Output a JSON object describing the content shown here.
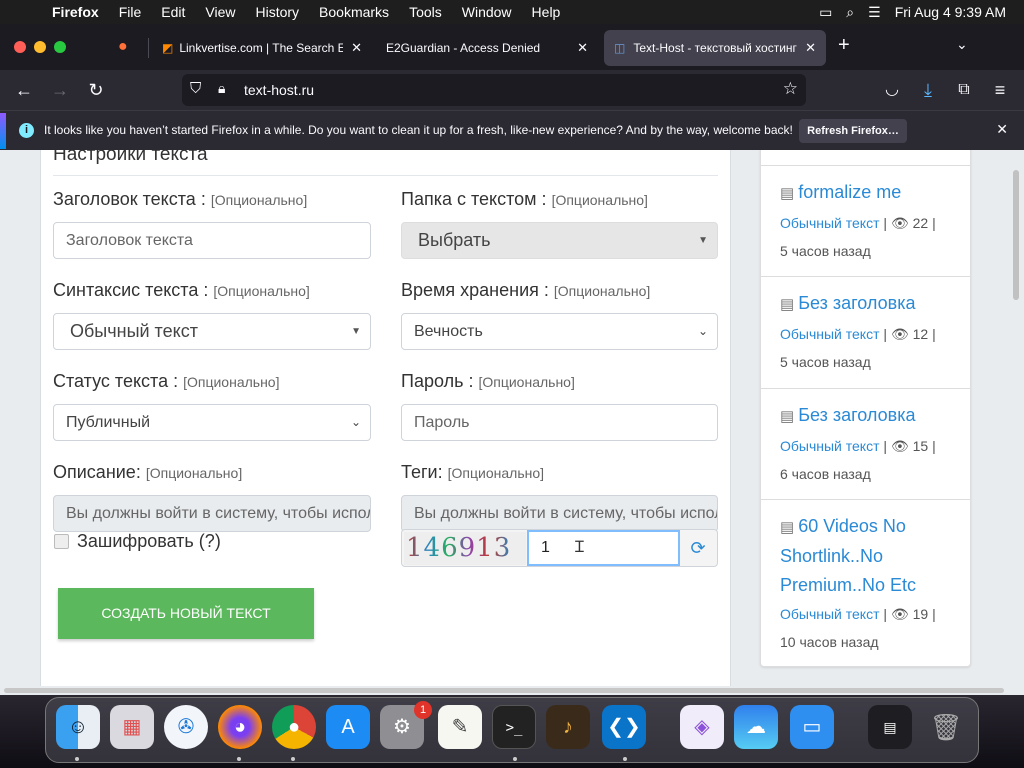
{
  "menubar": {
    "app": "Firefox",
    "items": [
      "File",
      "Edit",
      "View",
      "History",
      "Bookmarks",
      "Tools",
      "Window",
      "Help"
    ],
    "clock": "Fri Aug 4  9:39 AM"
  },
  "tabs": [
    {
      "title": "Linkvertise.com | The Search En",
      "active": false
    },
    {
      "title": "E2Guardian - Access Denied",
      "active": false
    },
    {
      "title": "Text-Host - текстовый хостинг",
      "active": true
    }
  ],
  "navbar": {
    "url": "text-host.ru"
  },
  "notification": {
    "message": "It looks like you haven’t started Firefox in a while. Do you want to clean it up for a fresh, like-new experience? And by the way, welcome back!",
    "button": "Refresh Firefox…"
  },
  "form": {
    "section_title": "Настройки текста",
    "optional": "[Опционально]",
    "title_label": "Заголовок текста :",
    "title_placeholder": "Заголовок текста",
    "folder_label": "Папка с текстом :",
    "folder_value": "Выбрать",
    "syntax_label": "Синтаксис текста :",
    "syntax_value": "Обычный текст",
    "expiry_label": "Время хранения :",
    "expiry_value": "Вечность",
    "status_label": "Статус текста :",
    "status_value": "Публичный",
    "password_label": "Пароль :",
    "password_placeholder": "Пароль",
    "description_label": "Описание:",
    "description_placeholder": "Вы должны войти в систему, чтобы использовать",
    "tags_label": "Теги:",
    "tags_placeholder": "Вы должны войти в систему, чтобы использовать",
    "encrypt_label": "Зашифровать (?)",
    "captcha_code": "146913",
    "captcha_value": "1",
    "submit": "Создать новый текст"
  },
  "sidebar": {
    "items": [
      {
        "title": "formalize me",
        "syntax": "Обычный текст",
        "views": "22",
        "time": "5 часов назад"
      },
      {
        "title": "Без заголовка",
        "syntax": "Обычный текст",
        "views": "12",
        "time": "5 часов назад"
      },
      {
        "title": "Без заголовка",
        "syntax": "Обычный текст",
        "views": "15",
        "time": "6 часов назад"
      },
      {
        "title": "60 Videos No Shortlink..No Premium..No Etc",
        "syntax": "Обычный текст",
        "views": "19",
        "time": "10 часов назад"
      }
    ]
  },
  "dock": {
    "apps": [
      "finder-icon",
      "launchpad-icon",
      "safari-icon",
      "firefox-icon",
      "chrome-icon",
      "app-store-icon",
      "system-settings-icon",
      "textedit-icon",
      "terminal-icon",
      "garageband-icon",
      "vscode-icon",
      "visual-studio-icon",
      "weather-icon",
      "keynote-icon",
      "downloads-stack-icon",
      "trash-icon"
    ],
    "settings_badge": "1"
  },
  "colors": {
    "accent": "#2a8ad5",
    "button_green": "#5cb85c",
    "browser_dark": "#2b2a33"
  }
}
